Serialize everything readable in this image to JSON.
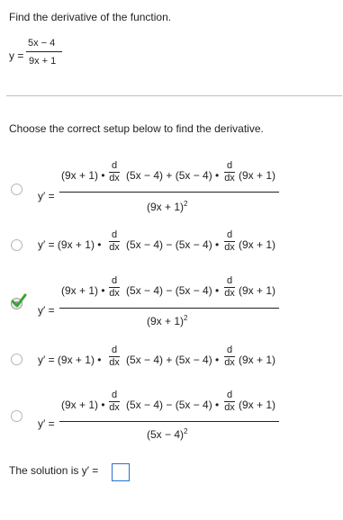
{
  "problem": {
    "instruction": "Find the derivative of the function.",
    "y_label": "y =",
    "numerator": "5x − 4",
    "denominator": "9x + 1"
  },
  "question": "Choose the correct setup below to find the derivative.",
  "options": [
    {
      "id": "A",
      "selected": false,
      "prefix": "y′ =",
      "term1": "(9x + 1) •",
      "mid": "(5x − 4) + (5x − 4) •",
      "term2": "(9x + 1)",
      "denominator": "(9x + 1)",
      "den_power": "2"
    },
    {
      "id": "B",
      "selected": false,
      "prefix": "y′ = (9x + 1) •",
      "mid": "(5x − 4) − (5x − 4) •",
      "term2": "(9x + 1)"
    },
    {
      "id": "C",
      "selected": true,
      "prefix": "y′ =",
      "term1": "(9x + 1) •",
      "mid": "(5x − 4) − (5x − 4) •",
      "term2": "(9x + 1)",
      "denominator": "(9x + 1)",
      "den_power": "2"
    },
    {
      "id": "D",
      "selected": false,
      "prefix": "y′ = (9x + 1) •",
      "mid": "(5x − 4) + (5x − 4) •",
      "term2": "(9x + 1)"
    },
    {
      "id": "E",
      "selected": false,
      "prefix": "y′ =",
      "term1": "(9x + 1) •",
      "mid": "(5x − 4) − (5x − 4) •",
      "term2": "(9x + 1)",
      "denominator": "(5x − 4)",
      "den_power": "2"
    }
  ],
  "d_symbol": {
    "num": "d",
    "den": "dx"
  },
  "solution": {
    "label": "The solution is y′ =",
    "answer_value": ""
  },
  "colors": {
    "check_green": "#3aa335",
    "input_border": "#2a6fd0",
    "separator": "#bfbfbf"
  }
}
